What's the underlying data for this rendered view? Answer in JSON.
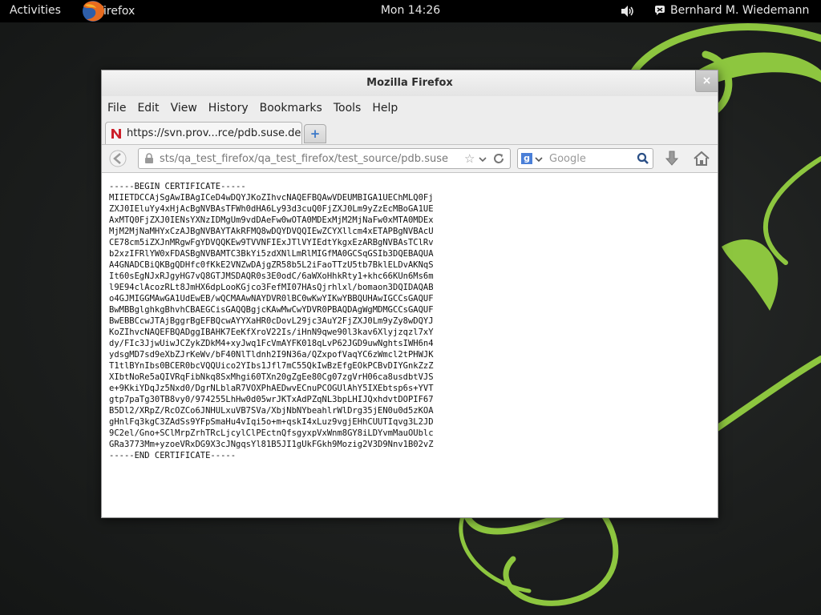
{
  "topbar": {
    "activities": "Activities",
    "app_name": "Firefox",
    "clock": "Mon 14:26",
    "user": "Bernhard M. Wiedemann"
  },
  "window": {
    "title": "Mozilla Firefox",
    "close_glyph": "×",
    "menu": {
      "file": "File",
      "edit": "Edit",
      "view": "View",
      "history": "History",
      "bookmarks": "Bookmarks",
      "tools": "Tools",
      "help": "Help"
    },
    "tab": {
      "title": "https://svn.prov...rce/pdb.suse.de"
    },
    "newtab_glyph": "+",
    "urlbar": {
      "value": "sts/qa_test_firefox/qa_test_firefox/test_source/pdb.suse"
    },
    "searchbar": {
      "engine_letter": "g",
      "placeholder": "Google"
    },
    "content": {
      "lines": [
        "-----BEGIN CERTIFICATE-----",
        "MIIETDCCAjSgAwIBAgICeD4wDQYJKoZIhvcNAQEFBQAwVDEUMBIGA1UEChMLQ0Fj",
        "ZXJ0IEluYy4xHjAcBgNVBAsTFWh0dHA6Ly93d3cuQ0FjZXJ0Lm9yZzEcMBoGA1UE",
        "AxMTQ0FjZXJ0IENsYXNzIDMgUm9vdDAeFw0wOTA0MDExMjM2MjNaFw0xMTA0MDEx",
        "MjM2MjNaMHYxCzAJBgNVBAYTAkRFMQ8wDQYDVQQIEwZCYXllcm4xETAPBgNVBAcU",
        "CE78cm5iZXJnMRgwFgYDVQQKEw9TVVNFIExJTlVYIEdtYkgxEzARBgNVBAsTClRv",
        "b2xzIFRlYW0xFDASBgNVBAMTC3BkYi5zdXNlLmRlMIGfMA0GCSqGSIb3DQEBAQUA",
        "A4GNADCBiQKBgQDHfc0fKkE2VNZwDAjgZR58b5L2iFaoTTzU5tb7BklELDvAKNqS",
        "It60sEgNJxRJgyHG7vQ8GTJMSDAQR0s3E0odC/6aWXoHhkRty1+khc66KUn6Ms6m",
        "l9E94clAcozRLt8JmHX6dpLooKGjco3FefMI07HAsQjrhlxl/bomaon3DQIDAQAB",
        "o4GJMIGGMAwGA1UdEwEB/wQCMAAwNAYDVR0lBC0wKwYIKwYBBQUHAwIGCCsGAQUF",
        "BwMBBglghkgBhvhCBAEGCisGAQQBgjcKAwMwCwYDVR0PBAQDAgWgMDMGCCsGAQUF",
        "BwEBBCcwJTAjBggrBgEFBQcwAYYXaHR0cDovL29jc3AuY2FjZXJ0Lm9yZy8wDQYJ",
        "KoZIhvcNAQEFBQADggIBAHK7EeKfXroV22Is/iHnN9qwe90l3kav6Xlyjzqzl7xY",
        "dy/FIc3JjwUiwJCZykZDkM4+xyJwq1FcVmAYFK018qLvP62JGD9uwNghtsIWH6n4",
        "ydsgMD7sd9eXbZJrKeWv/bF40NlTldnh2I9N36a/QZxpofVaqYC6zWmcl2tPHWJK",
        "T1tlBYnIbs0BCER0bcVQQUico2YIbs1Jfl7mC55QkIwBzEfgEOkPCBvDIYGnkZzZ",
        "XIbtNoRe5aQIVRqFibNkq8SxMhgi60TXn20gZgEe80Cg07zgVrH06ca8usdbtVJS",
        "e+9KkiYDqJz5Nxd0/DgrNLblaR7VOXPhAEDwvECnuPCOGUlAhY5IXEbtsp6s+YVT",
        "gtp7paTg30TB8vy0/974255LhHw0d05wrJKTxAdPZqNL3bpLHIJQxhdvtDOPIF67",
        "B5Dl2/XRpZ/RcOZCo6JNHULxuVB7SVa/XbjNbNYbeahlrWlDrg35jEN0u0d5zKOA",
        "gHnlFq3kgC3ZAdSs9YFpSmaHu4vIqi5o+m+qskI4xLuz9vgjEHhCUUTIqvg3L2JD",
        "9C2el/Gno+SClMrpZrhTRcLjcylClPEctnQfsgyxpVxWnm8GY8iLDYvmMauOUblc",
        "GRa3773Mm+yzoeVRxDG9X3cJNgqsYl81B5JI1gUkFGkh9Mozig2V3D9Nnv1B02vZ",
        "-----END CERTIFICATE-----"
      ]
    }
  },
  "icons": {
    "firefox": "firefox-logo-icon",
    "volume": "volume-icon",
    "chat": "chat-status-icon",
    "favicon": "site-favicon-icon",
    "back": "back-arrow-icon",
    "lock": "lock-icon",
    "star": "bookmark-star-icon",
    "reload": "reload-icon",
    "search": "search-icon",
    "download": "download-icon",
    "home": "home-icon"
  },
  "colors": {
    "topbar_bg": "#000000",
    "swirl_green": "#8dc63f",
    "favicon_red": "#cc1f2a"
  }
}
